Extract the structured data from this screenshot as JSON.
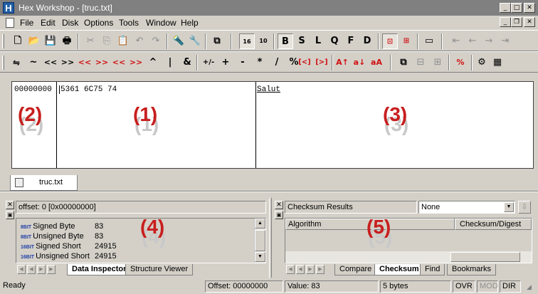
{
  "window": {
    "app_icon_letter": "H",
    "title": "Hex Workshop - [truc.txt]"
  },
  "menu": [
    "File",
    "Edit",
    "Disk",
    "Options",
    "Tools",
    "Window",
    "Help"
  ],
  "toolbar": {
    "format_letters": [
      "B",
      "S",
      "L",
      "Q",
      "F",
      "D"
    ],
    "operators": [
      "⇋",
      "~",
      "<<",
      ">>",
      "<<",
      ">>",
      "<<",
      ">>",
      "^",
      "|",
      "&",
      "+/-",
      "+",
      "-",
      "*",
      "/",
      "%",
      "[<]",
      "[>]",
      "A↑",
      "a↓",
      "aA"
    ]
  },
  "editor": {
    "offset": "00000000",
    "hex": "5361 6C75 74",
    "ascii": "Salut",
    "labels": {
      "offset": "(2)",
      "hex": "(1)",
      "ascii": "(3)"
    }
  },
  "doc_tab": {
    "label": "truc.txt"
  },
  "data_inspector": {
    "header": "offset: 0 [0x00000000]",
    "label": "(4)",
    "bit_8": "8BIT",
    "bit_16": "16BIT",
    "rows": [
      {
        "bits": "8",
        "name": "Signed Byte",
        "value": "83"
      },
      {
        "bits": "8",
        "name": "Unsigned Byte",
        "value": "83"
      },
      {
        "bits": "16",
        "name": "Signed Short",
        "value": "24915"
      },
      {
        "bits": "16",
        "name": "Unsigned Short",
        "value": "24915"
      }
    ],
    "tabs": [
      "Data Inspector",
      "Structure Viewer"
    ]
  },
  "checksum": {
    "header": "Checksum Results",
    "select_value": "None",
    "columns": [
      "Algorithm",
      "Checksum/Digest"
    ],
    "label": "(5)",
    "tabs": [
      "Compare",
      "Checksum",
      "Find",
      "Bookmarks"
    ]
  },
  "status": {
    "ready": "Ready",
    "offset": "Offset: 00000000",
    "value": "Value: 83",
    "size": "5 bytes",
    "ovr": "OVR",
    "mod": "MOD",
    "dir": "DIR"
  }
}
